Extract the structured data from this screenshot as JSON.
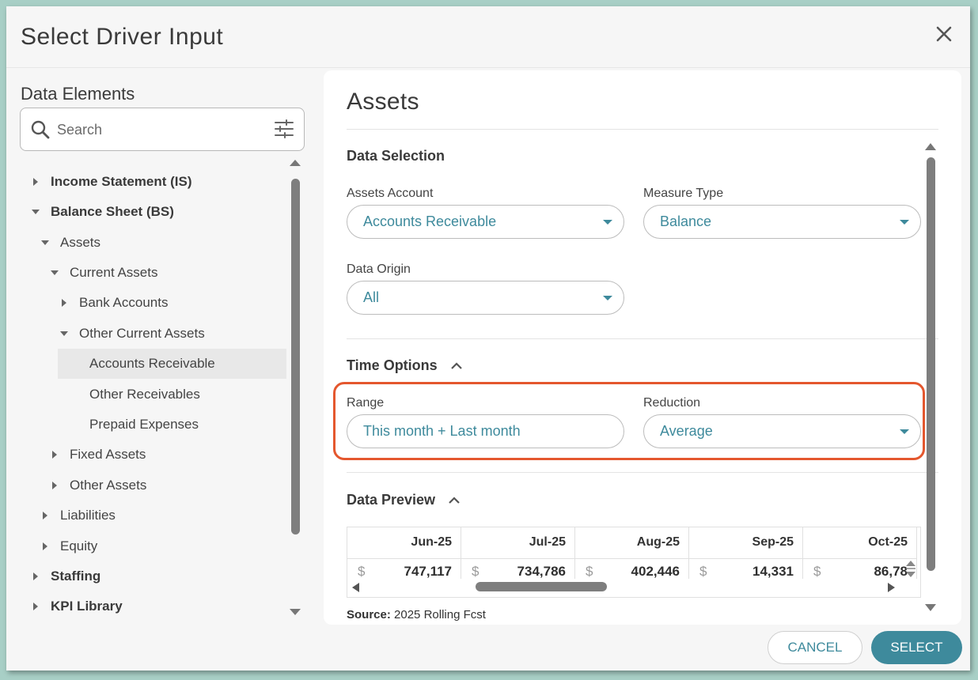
{
  "dialog": {
    "title": "Select Driver Input",
    "close_icon": "close-icon"
  },
  "left": {
    "title": "Data Elements",
    "search_placeholder": "Search",
    "tree": [
      {
        "label": "Income Statement (IS)",
        "expanded": false,
        "bold": true
      },
      {
        "label": "Balance Sheet (BS)",
        "expanded": true,
        "bold": true
      },
      {
        "label": "Assets",
        "expanded": true
      },
      {
        "label": "Current Assets",
        "expanded": true
      },
      {
        "label": "Bank Accounts",
        "expanded": false
      },
      {
        "label": "Other Current Assets",
        "expanded": true
      },
      {
        "label": "Accounts Receivable",
        "selected": true
      },
      {
        "label": "Other Receivables"
      },
      {
        "label": "Prepaid Expenses"
      },
      {
        "label": "Fixed Assets",
        "expanded": false
      },
      {
        "label": "Other Assets",
        "expanded": false
      },
      {
        "label": "Liabilities",
        "expanded": false
      },
      {
        "label": "Equity",
        "expanded": false
      },
      {
        "label": "Staffing",
        "expanded": false,
        "bold": true
      },
      {
        "label": "KPI Library",
        "expanded": false,
        "bold": true
      }
    ]
  },
  "right": {
    "title": "Assets",
    "data_selection": {
      "title": "Data Selection",
      "assets_account_label": "Assets Account",
      "assets_account_value": "Accounts Receivable",
      "measure_type_label": "Measure Type",
      "measure_type_value": "Balance",
      "data_origin_label": "Data Origin",
      "data_origin_value": "All"
    },
    "time_options": {
      "title": "Time Options",
      "range_label": "Range",
      "range_value": "This month + Last month",
      "reduction_label": "Reduction",
      "reduction_value": "Average"
    },
    "data_preview": {
      "title": "Data Preview",
      "columns": [
        "Jun-25",
        "Jul-25",
        "Aug-25",
        "Sep-25",
        "Oct-25"
      ],
      "currency": "$",
      "values": [
        "747,117",
        "734,786",
        "402,446",
        "14,331",
        "86,78"
      ],
      "source_label": "Source:",
      "source_value": "2025 Rolling Fcst"
    }
  },
  "footer": {
    "cancel_label": "CANCEL",
    "select_label": "SELECT"
  },
  "colors": {
    "accent": "#3e8a9c",
    "highlight": "#e4572e"
  }
}
